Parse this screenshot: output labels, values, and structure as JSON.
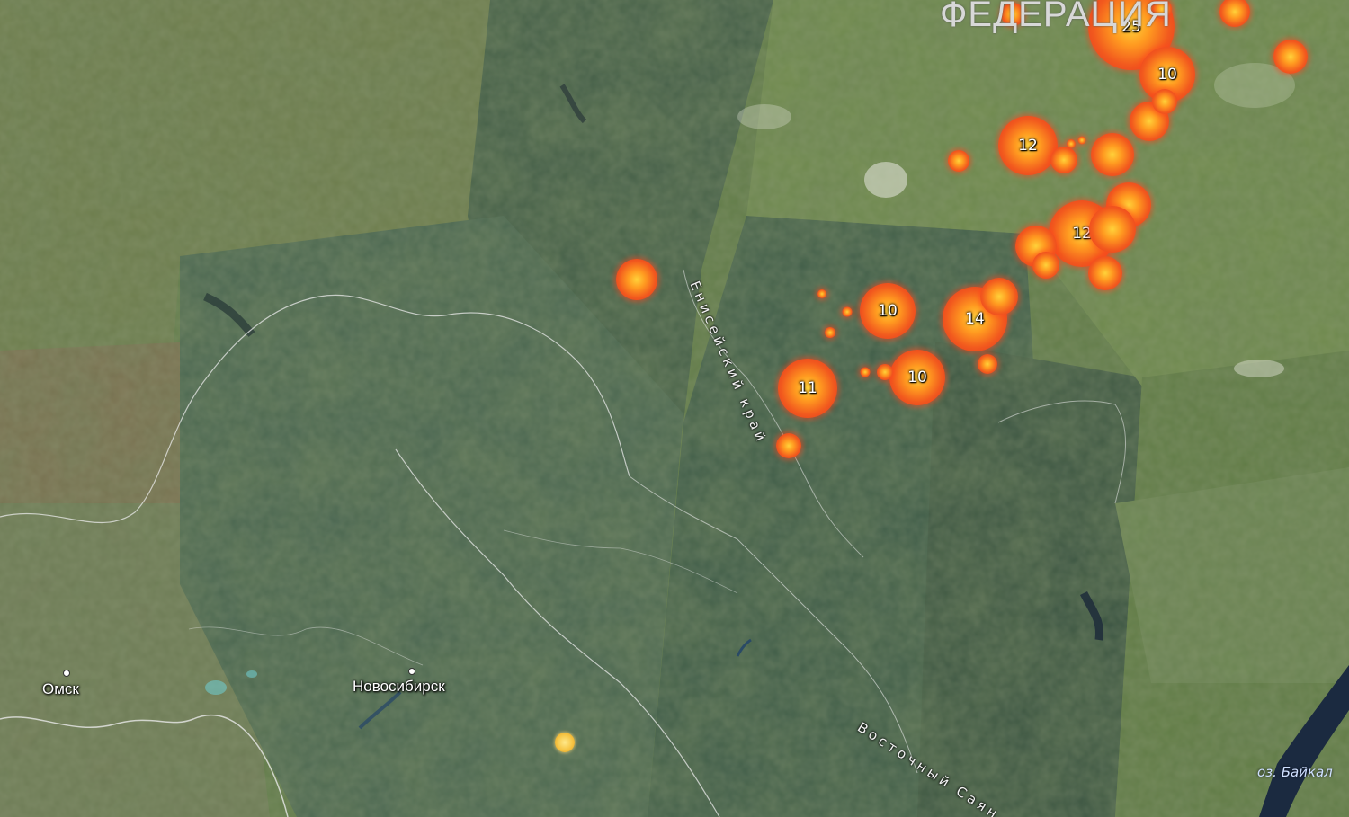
{
  "map": {
    "country_label": "ФЕДЕРАЦИЯ",
    "cities": [
      {
        "id": "omsk",
        "name": "Омск"
      },
      {
        "id": "novosibirsk",
        "name": "Новосибирск"
      }
    ],
    "region_labels": {
      "krasnoyarsk": "Енисейский край",
      "sayan": "Восточный Саян"
    },
    "lake_label": "оз. Байкал",
    "fire_clusters": [
      {
        "id": "c25",
        "count": "25"
      },
      {
        "id": "c10a",
        "count": "10"
      },
      {
        "id": "c12a",
        "count": "12"
      },
      {
        "id": "c12b",
        "count": "12"
      },
      {
        "id": "c10b",
        "count": "10"
      },
      {
        "id": "c14",
        "count": "14"
      },
      {
        "id": "c11",
        "count": "11"
      },
      {
        "id": "c10c",
        "count": "10"
      }
    ],
    "colors": {
      "fire_outer": "#e8281e",
      "fire_mid": "#f25a1e",
      "fire_core": "#ffd23a",
      "hotspot_yellow": "#f6c544",
      "label_text": "#ffffff"
    }
  }
}
